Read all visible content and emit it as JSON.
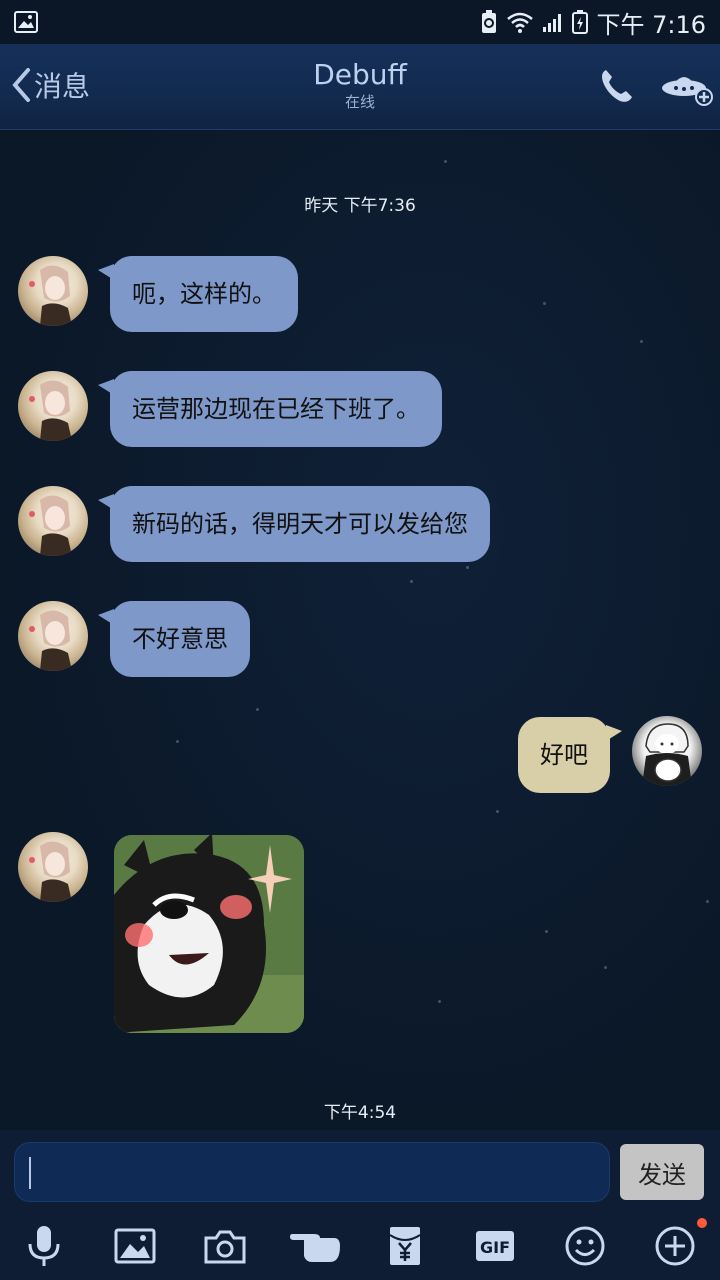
{
  "status_bar": {
    "time": "下午 7:16"
  },
  "header": {
    "back_label": "消息",
    "contact_name": "Debuff",
    "contact_status": "在线"
  },
  "chat": {
    "timestamp_1": "昨天 下午7:36",
    "messages": [
      {
        "from": "them",
        "text": "呃，这样的。"
      },
      {
        "from": "them",
        "text": "运营那边现在已经下班了。"
      },
      {
        "from": "them",
        "text": "新码的话，得明天才可以发给您"
      },
      {
        "from": "them",
        "text": "不好意思"
      },
      {
        "from": "me",
        "text": "好吧"
      }
    ],
    "timestamp_2": "下午4:54"
  },
  "input": {
    "send_label": "发送"
  },
  "toolbar": {
    "gif_label": "GIF",
    "icons": [
      "microphone-icon",
      "image-icon",
      "camera-icon",
      "poke-icon",
      "red-envelope-icon",
      "gif-icon",
      "emoji-icon",
      "plus-icon"
    ]
  },
  "colors": {
    "incoming_bubble": "#7e98c9",
    "outgoing_bubble": "#d8cfa8",
    "background": "#0c1a30",
    "notification_dot": "#ff5a3c"
  }
}
